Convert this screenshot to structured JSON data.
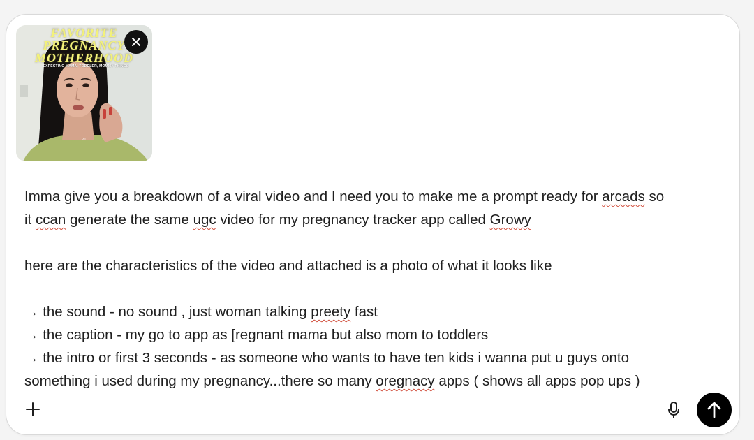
{
  "attachment": {
    "title_line1": "FAVORITE",
    "title_line2": "PREGNANCY",
    "title_line3": "MOTHERHOOD",
    "subtitle": "EXPECTING MAMA, TODDLER, MOMMY THINGS",
    "remove_icon": "close-icon"
  },
  "message": {
    "line1_a": "Imma give you a breakdown of a viral video and I need you to make me a prompt ready for ",
    "line1_sp": "arcads",
    "line1_b": " so",
    "line2_a": "it ",
    "line2_sp1": "ccan",
    "line2_b": " generate the same ",
    "line2_sp2": "ugc",
    "line2_c": " video for my pregnancy tracker app called ",
    "line2_sp3": "Growy",
    "line3": "here are the characteristics of the video and attached is a photo of what it looks like",
    "line4_a": "→ the sound - no sound , just woman talking ",
    "line4_sp": "preety",
    "line4_b": " fast",
    "line5": "→ the caption - my go to app as [regnant mama but also mom to toddlers",
    "line6": "→ the intro or first 3 seconds - as someone who wants to have ten kids i wanna put u guys onto",
    "line7_a": "something i used during my pregnancy...there so many ",
    "line7_sp": "oregnacy",
    "line7_b": " apps ( shows all apps pop ups )"
  },
  "toolbar": {
    "plus_icon": "plus-icon",
    "mic_icon": "microphone-icon",
    "send_icon": "arrow-up-icon"
  }
}
